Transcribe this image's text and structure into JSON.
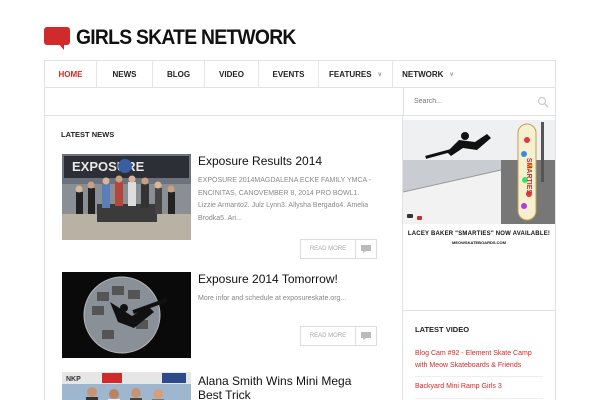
{
  "site": {
    "title": "GIRLS SKATE NETWORK"
  },
  "nav": {
    "items": [
      {
        "label": "HOME",
        "active": true,
        "dropdown": false
      },
      {
        "label": "NEWS",
        "active": false,
        "dropdown": false
      },
      {
        "label": "BLOG",
        "active": false,
        "dropdown": false
      },
      {
        "label": "VIDEO",
        "active": false,
        "dropdown": false
      },
      {
        "label": "EVENTS",
        "active": false,
        "dropdown": false
      },
      {
        "label": "FEATURES",
        "active": false,
        "dropdown": true
      },
      {
        "label": "NETWORK",
        "active": false,
        "dropdown": true
      }
    ]
  },
  "search": {
    "placeholder": "Search..."
  },
  "main": {
    "section_title": "LATEST NEWS",
    "posts": [
      {
        "title": "Exposure Results 2014",
        "excerpt": "EXPOSURE 2014MAGDALENA ECKE FAMILY YMCA - ENCINITAS, CANOVEMBER 8, 2014 PRO BOWL1. Lizzie Armanto2. Julz Lynn3. Allysha Bergado4. Amelia Brodka5. Ari...",
        "read_more": "READ MORE",
        "thumb_text": "EXPOSURE"
      },
      {
        "title": "Exposure 2014 Tomorrow!",
        "excerpt": "More infor and schedule at exposureskate.org...",
        "read_more": "READ MORE"
      },
      {
        "title": "Alana Smith Wins Mini Mega Best Trick",
        "thumb_text": "NKP"
      }
    ]
  },
  "sidebar": {
    "ad": {
      "caption": "LACEY BAKER \"SMARTIES\" NOW AVAILABLE!",
      "url_text": "MEOWSKATEBOARDS.COM",
      "board_text": "SMARTIES"
    },
    "latest_video": {
      "title": "LATEST VIDEO",
      "items": [
        "Blog Cam #92 - Element Skate Camp with Meow Skateboards & Friends",
        "Backyard Mini Ramp Girls 3"
      ]
    }
  },
  "colors": {
    "accent": "#d02a2a",
    "border": "#e2e2e2",
    "text": "#222222",
    "muted": "#888888"
  }
}
